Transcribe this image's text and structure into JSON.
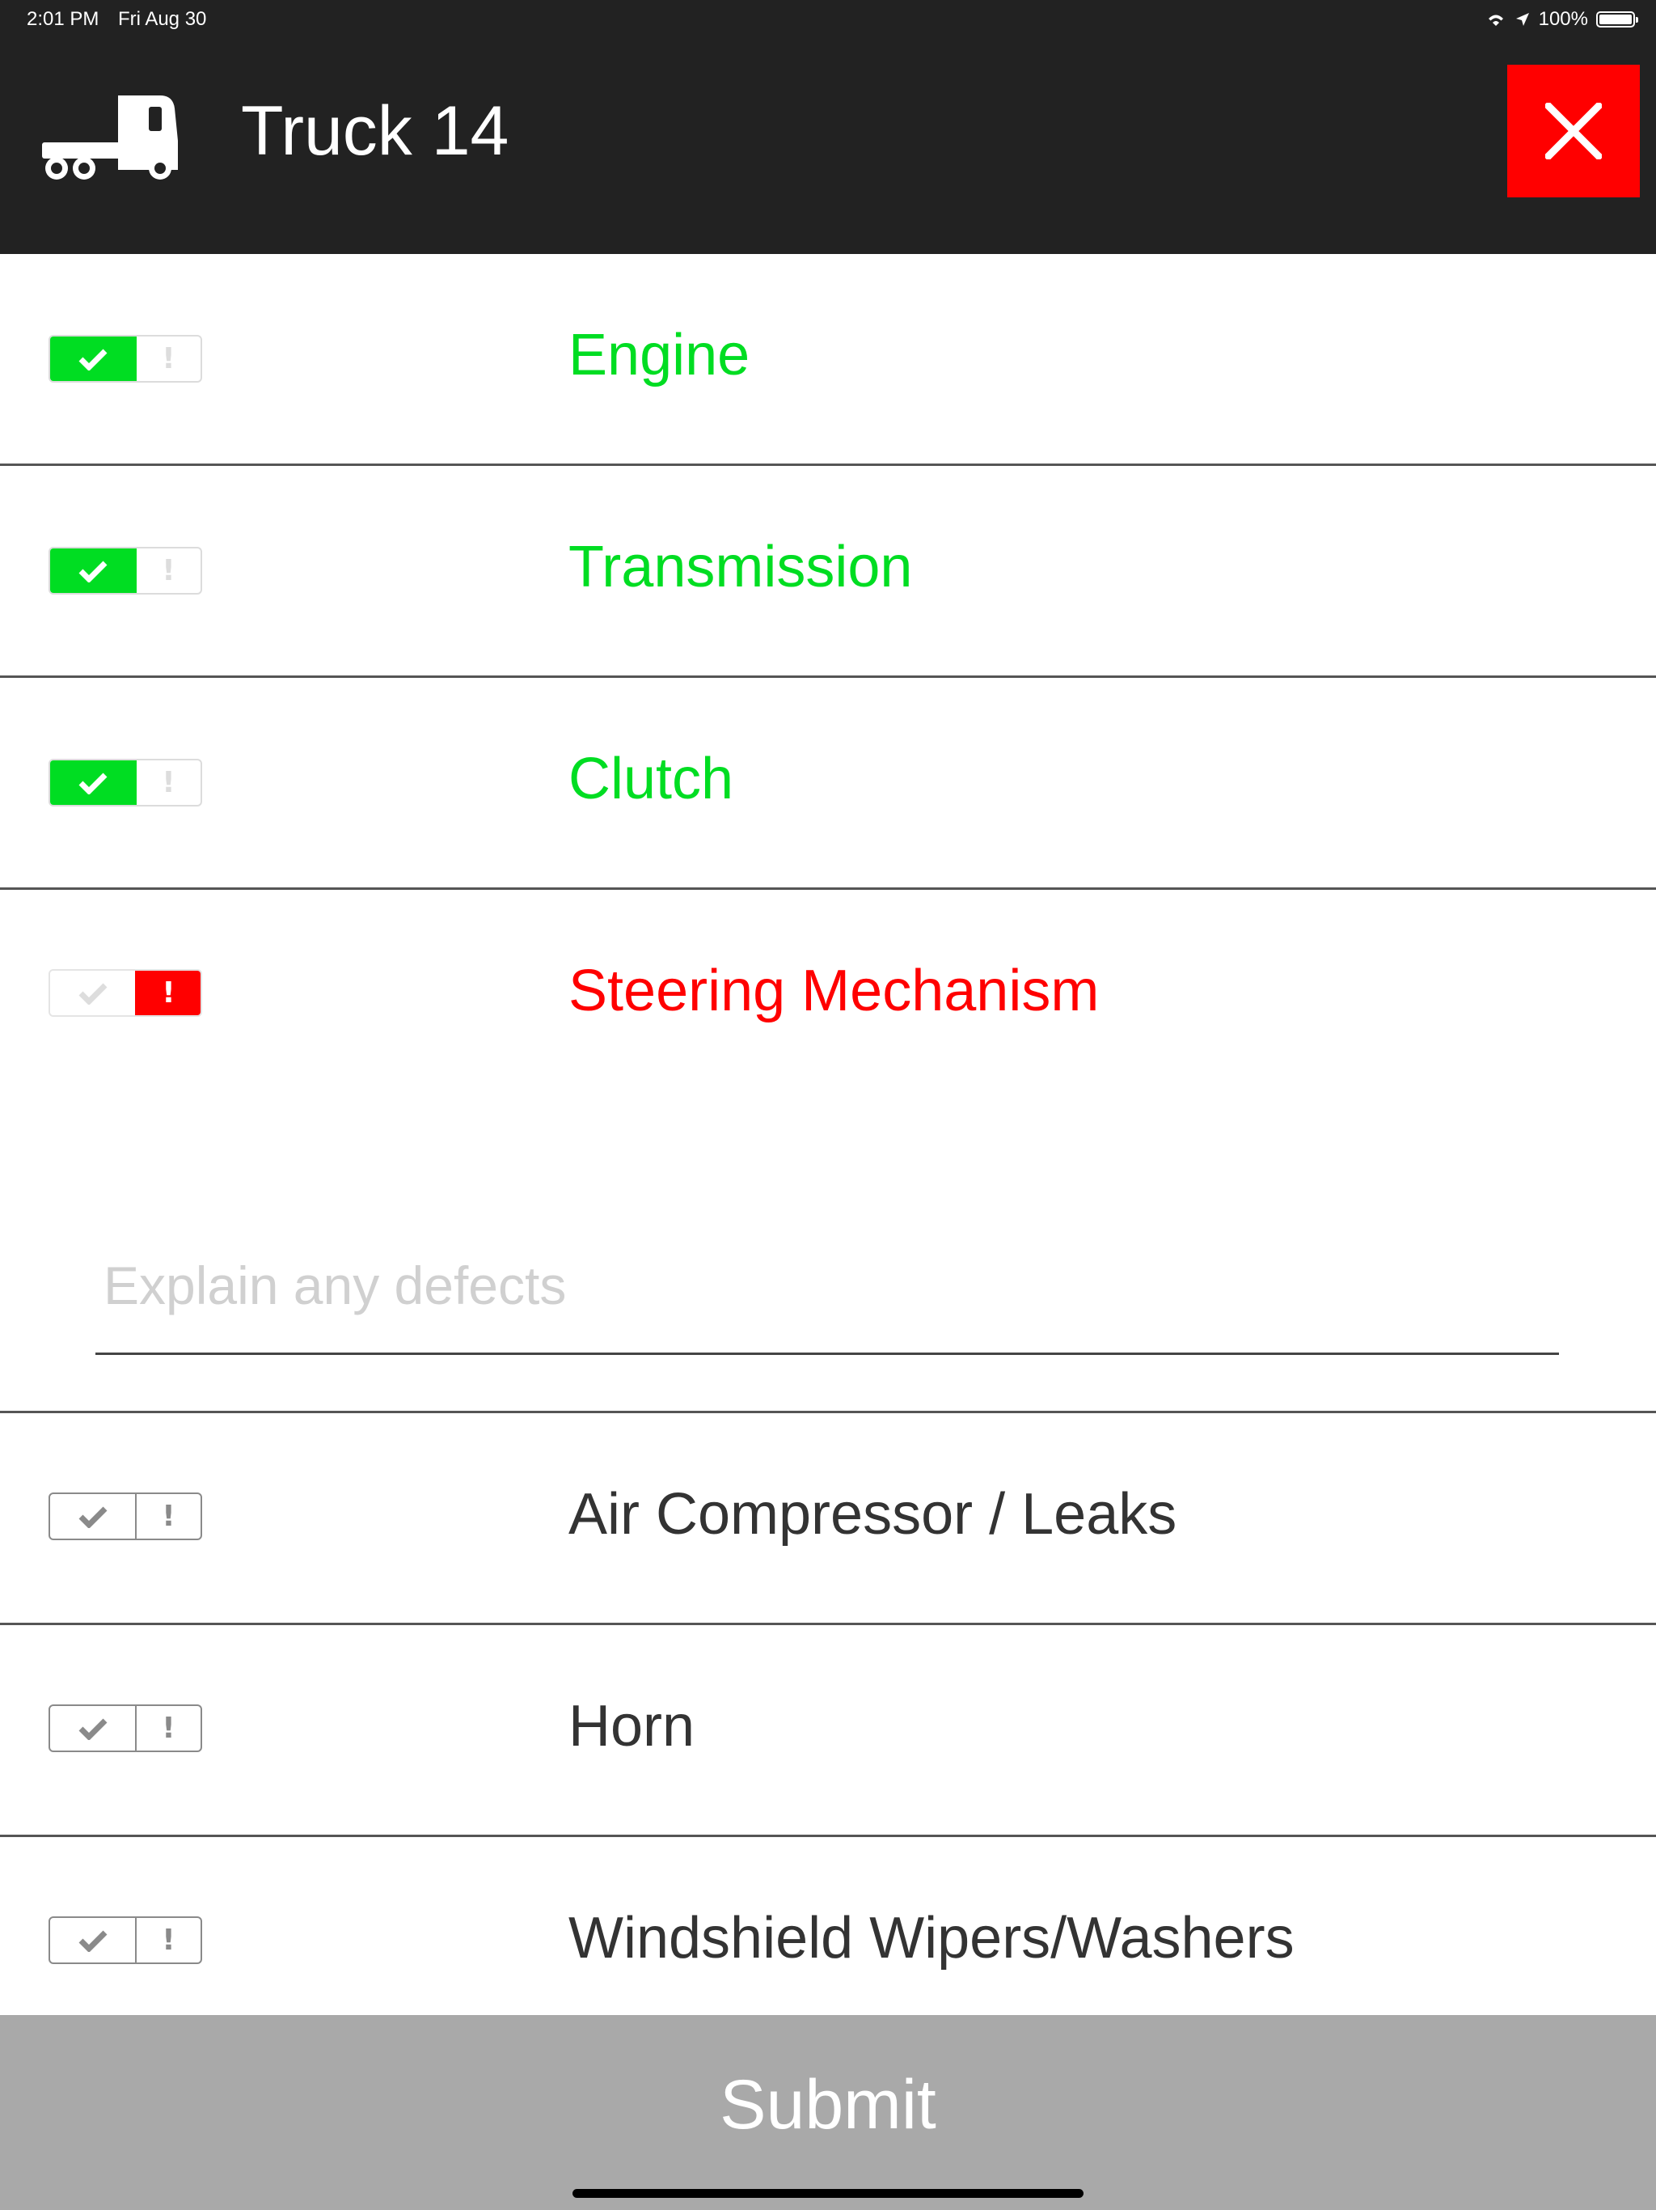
{
  "status_bar": {
    "time": "2:01 PM",
    "date": "Fri Aug 30",
    "battery": "100%"
  },
  "header": {
    "title": "Truck 14",
    "icon": "truck-icon",
    "close_icon": "close-icon"
  },
  "colors": {
    "header_bg": "#222222",
    "ok_green": "#00dd22",
    "defect_red": "#ff0000",
    "submit_bg": "#a9a9a9"
  },
  "checklist": {
    "items": [
      {
        "label": "Engine",
        "status": "ok"
      },
      {
        "label": "Transmission",
        "status": "ok"
      },
      {
        "label": "Clutch",
        "status": "ok"
      },
      {
        "label": "Steering Mechanism",
        "status": "defect"
      },
      {
        "label": "Air Compressor / Leaks",
        "status": "none"
      },
      {
        "label": "Horn",
        "status": "none"
      },
      {
        "label": "Windshield Wipers/Washers",
        "status": "none"
      }
    ],
    "ok_icon": "check-icon",
    "defect_icon": "exclamation-icon",
    "defect_symbol": "!"
  },
  "defect_note": {
    "placeholder": "Explain any defects",
    "value": ""
  },
  "submit": {
    "label": "Submit"
  }
}
